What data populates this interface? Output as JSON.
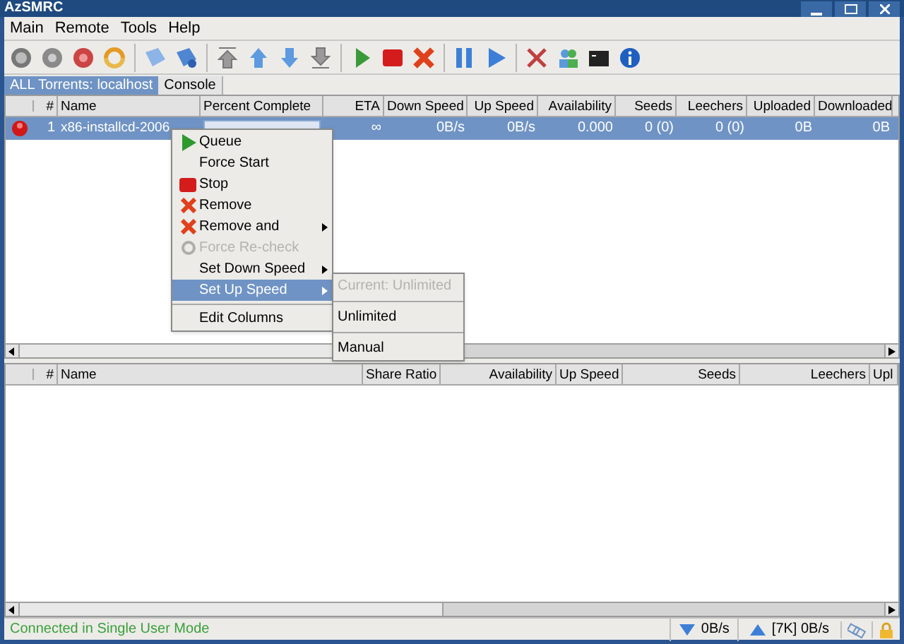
{
  "window": {
    "title": "AzSMRC"
  },
  "menu_bar": [
    "Main",
    "Remote",
    "Tools",
    "Help"
  ],
  "tabs": [
    {
      "label": "ALL Torrents: localhost",
      "selected": true
    },
    {
      "label": "Console",
      "selected": false
    }
  ],
  "torrent_table": {
    "columns": [
      "#",
      "Name",
      "Percent Complete",
      "ETA",
      "Down Speed",
      "Up Speed",
      "Availability",
      "Seeds",
      "Leechers",
      "Uploaded",
      "Downloaded"
    ],
    "rows": [
      {
        "selected": true,
        "number": "1",
        "name": "x86-installcd-2006",
        "level": 0,
        "eta": "∞",
        "down_speed": "0B/s",
        "up_speed": "0B/s",
        "availability": "0.000",
        "seeds": "0 (0)",
        "leechers": "0 (0)",
        "uploaded": "0B",
        "downloaded": "0B"
      }
    ]
  },
  "context_menu": {
    "items": [
      {
        "kind": "item",
        "label": "Queue",
        "disabled": false,
        "selected": false,
        "submenu": false
      },
      {
        "kind": "item",
        "label": "Force Start",
        "disabled": false,
        "selected": false,
        "submenu": false
      },
      {
        "kind": "item",
        "label": "Stop",
        "disabled": false,
        "selected": false,
        "submenu": false
      },
      {
        "kind": "item",
        "label": "Remove",
        "disabled": false,
        "selected": false,
        "submenu": false
      },
      {
        "kind": "item",
        "label": "Remove and",
        "disabled": false,
        "selected": false,
        "submenu": true
      },
      {
        "kind": "item",
        "label": "Force Re-check",
        "disabled": true,
        "selected": false,
        "submenu": false
      },
      {
        "kind": "item",
        "label": "Set Down Speed",
        "disabled": false,
        "selected": false,
        "submenu": true
      },
      {
        "kind": "item",
        "label": "Set Up Speed",
        "disabled": false,
        "selected": true,
        "submenu": true
      },
      {
        "kind": "separator"
      },
      {
        "kind": "item",
        "label": "Edit Columns",
        "disabled": false,
        "selected": false,
        "submenu": false
      }
    ]
  },
  "submenu": {
    "items": [
      {
        "kind": "item",
        "label": "Current: Unlimited",
        "disabled": true
      },
      {
        "kind": "separator"
      },
      {
        "kind": "item",
        "label": "Unlimited",
        "disabled": false
      },
      {
        "kind": "separator"
      },
      {
        "kind": "item",
        "label": "Manual",
        "disabled": false
      }
    ]
  },
  "files_table": {
    "columns": [
      "#",
      "Name",
      "Share Ratio",
      "Availability",
      "Up Speed",
      "Seeds",
      "Leechers",
      "Upl"
    ]
  },
  "status_bar": {
    "message": "Connected in Single User Mode",
    "down_speed": "0B/s",
    "up_speed": "[7K] 0B/s"
  }
}
